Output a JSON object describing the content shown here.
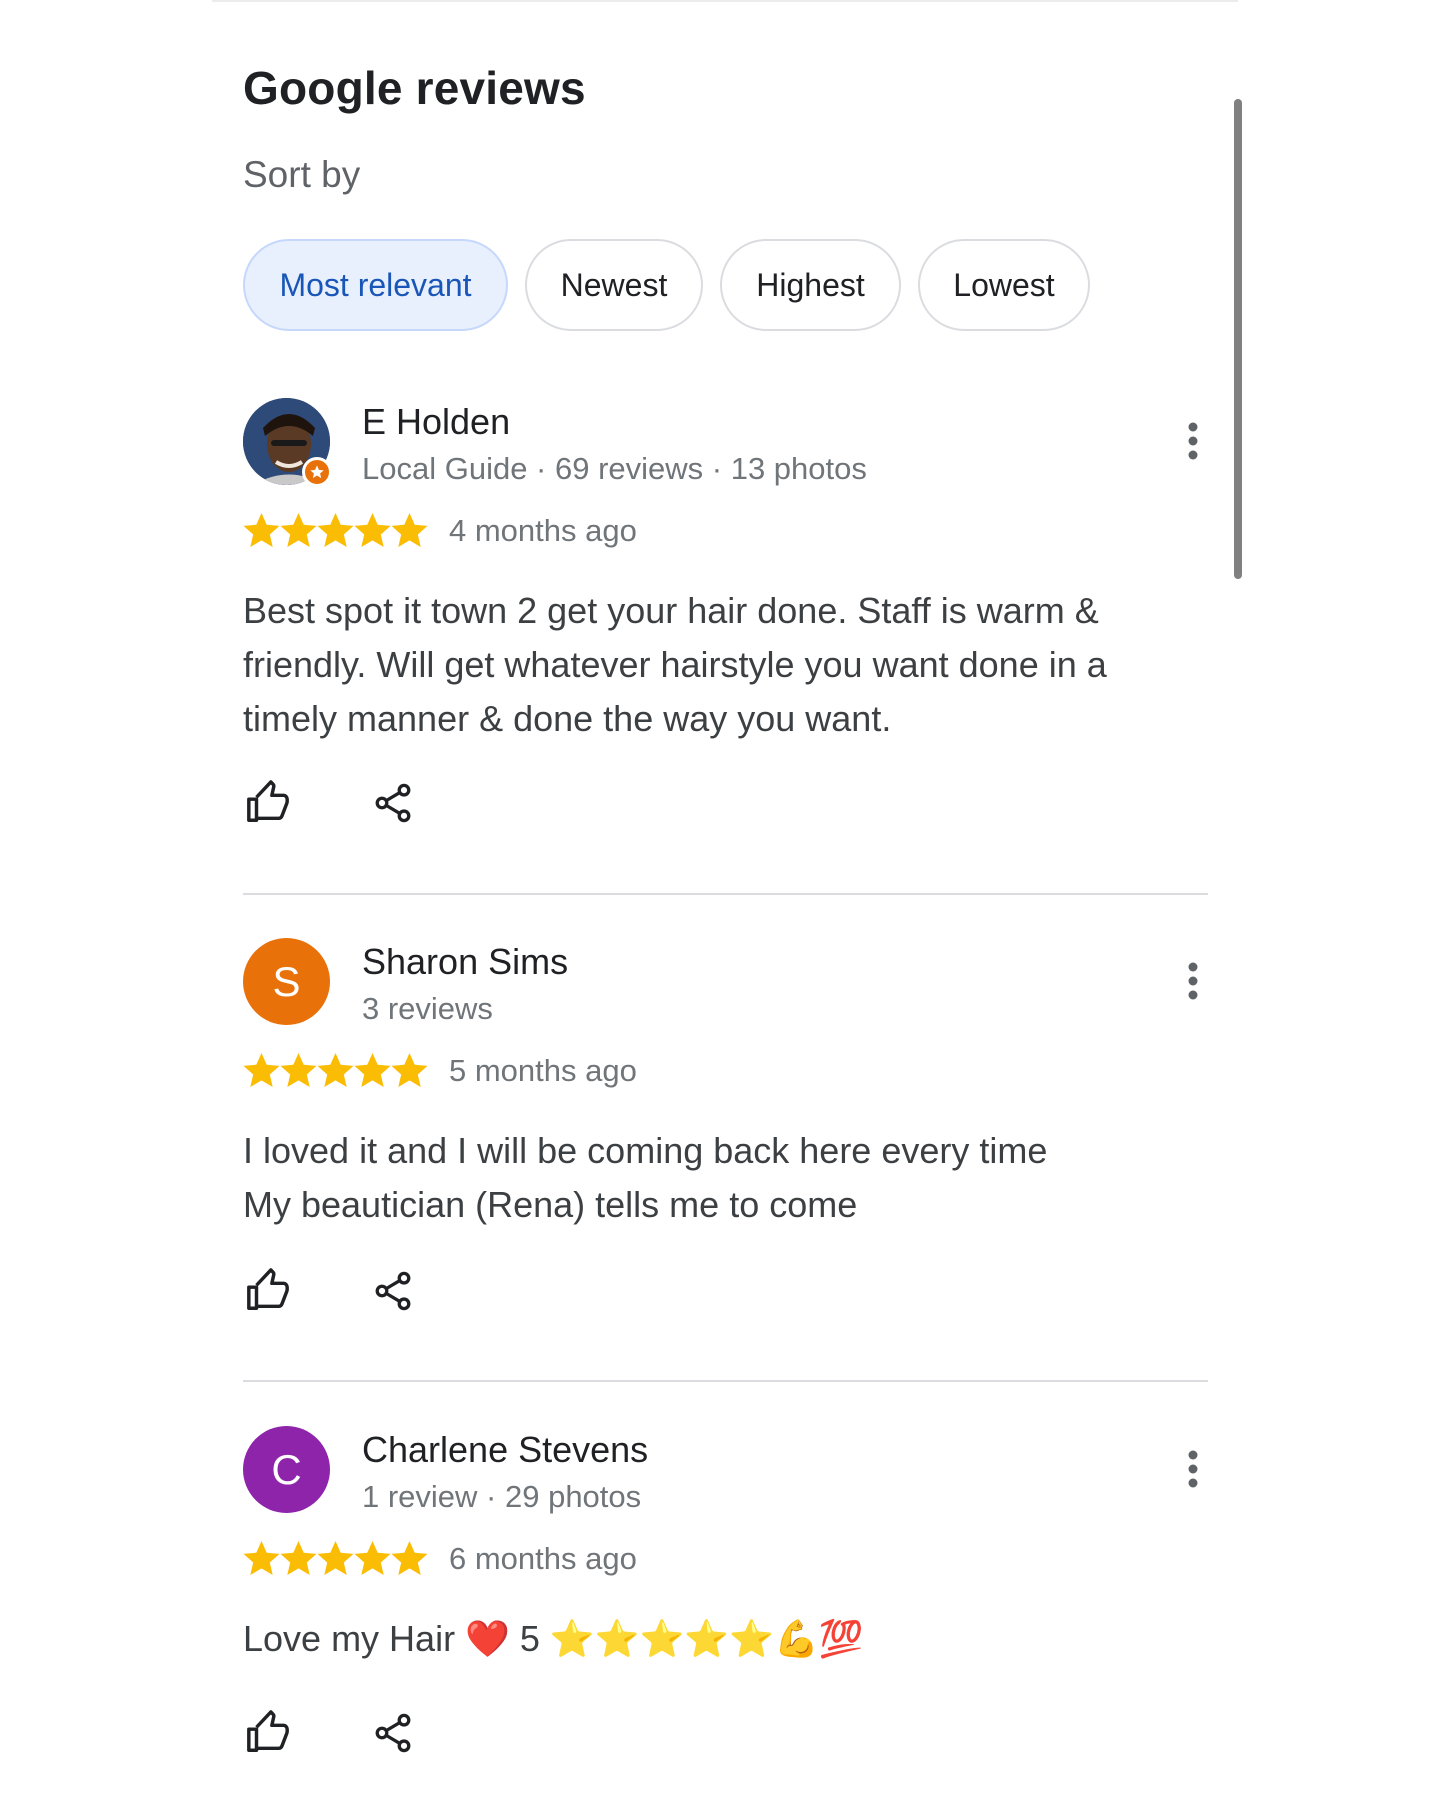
{
  "header": {
    "title": "Google reviews",
    "sort_label": "Sort by"
  },
  "sort": {
    "options": [
      "Most relevant",
      "Newest",
      "Highest",
      "Lowest"
    ],
    "selected": "Most relevant"
  },
  "colors": {
    "star": "#fbbc04",
    "chip_selected_bg": "#e8f0fe",
    "chip_selected_text": "#1a56b8",
    "avatar_s": "#e8710a",
    "avatar_c": "#8e24aa",
    "local_guide_badge": "#e8710a"
  },
  "icons": {
    "star": "star-icon",
    "like": "thumb-up-icon",
    "share": "share-icon",
    "more": "more-vertical-icon",
    "local_guide": "local-guide-badge-icon"
  },
  "reviews": [
    {
      "name": "E Holden",
      "avatar_type": "photo",
      "meta": "Local Guide · 69 reviews · 13 photos",
      "rating": 5,
      "when": "4 months ago",
      "text": "Best spot it town 2 get your hair done. Staff is warm & friendly. Will get whatever hairstyle you want done in a timely manner & done the way you want."
    },
    {
      "name": "Sharon Sims",
      "avatar_letter": "S",
      "meta": "3 reviews",
      "rating": 5,
      "when": "5 months ago",
      "text_lines": [
        "I loved it and I will be coming back here every time",
        "My beautician (Rena) tells me to come"
      ]
    },
    {
      "name": "Charlene Stevens",
      "avatar_letter": "C",
      "meta": "1 review · 29 photos",
      "rating": 5,
      "when": "6 months ago",
      "text": "Love my Hair ❤️ 5 ⭐⭐⭐⭐⭐💪💯"
    }
  ]
}
